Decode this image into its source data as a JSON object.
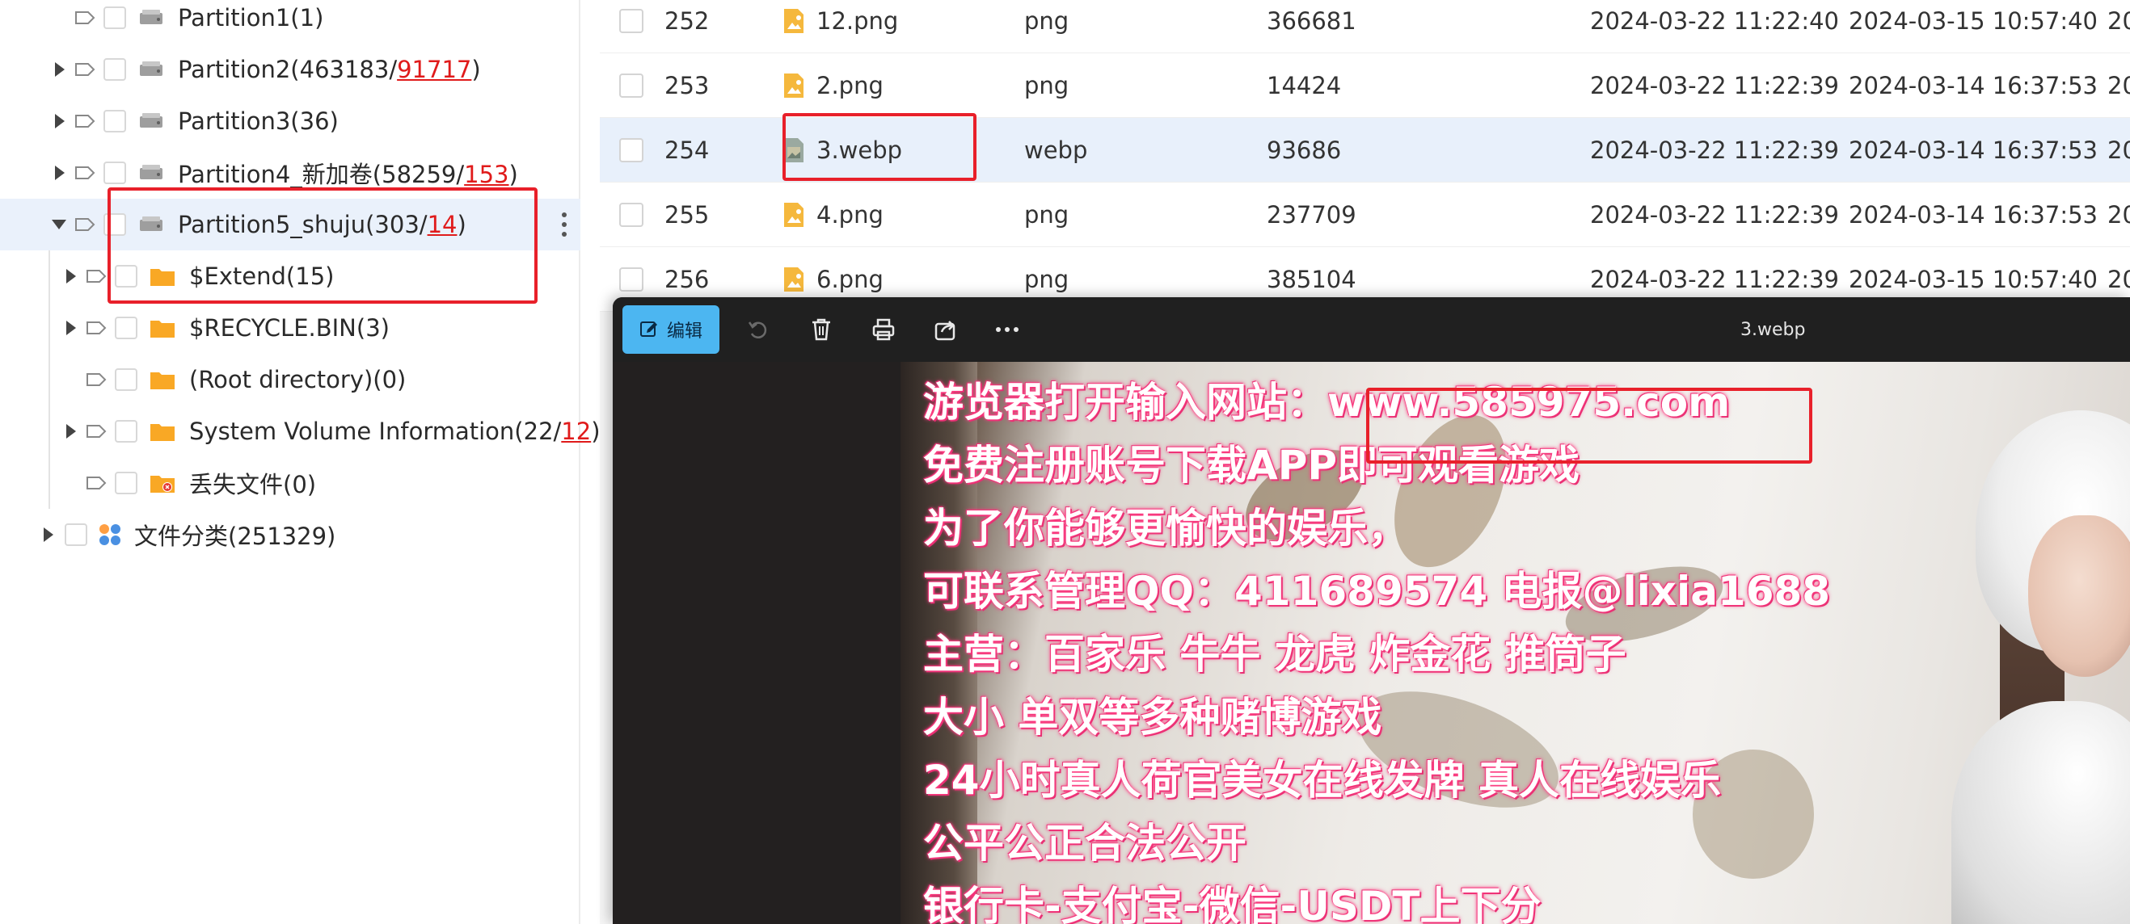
{
  "tree": {
    "items": [
      {
        "label": "Partition1(1)",
        "red": "",
        "tail": ""
      },
      {
        "label": "Partition2(463183/",
        "red": "91717",
        "tail": ")"
      },
      {
        "label": "Partition3(36)",
        "red": "",
        "tail": ""
      },
      {
        "label": "Partition4_新加卷(58259/",
        "red": "153",
        "tail": ")"
      },
      {
        "label": "Partition5_shuju(303/",
        "red": "14",
        "tail": ")"
      },
      {
        "label": "$Extend(15)",
        "red": "",
        "tail": ""
      },
      {
        "label": "$RECYCLE.BIN(3)",
        "red": "",
        "tail": ""
      },
      {
        "label": "(Root directory)(0)",
        "red": "",
        "tail": ""
      },
      {
        "label": "System Volume Information(22/",
        "red": "12",
        "tail": ")"
      },
      {
        "label": "丢失文件(0)",
        "red": "",
        "tail": ""
      },
      {
        "label": "文件分类(251329)",
        "red": "",
        "tail": ""
      }
    ]
  },
  "table": {
    "rows": [
      {
        "id": "252",
        "name": "12.png",
        "type": "png",
        "size": "366681",
        "modified": "2024-03-22 11:22:40",
        "created": "2024-03-15 10:57:40",
        "extra": "20"
      },
      {
        "id": "253",
        "name": "2.png",
        "type": "png",
        "size": "14424",
        "modified": "2024-03-22 11:22:39",
        "created": "2024-03-14 16:37:53",
        "extra": "20"
      },
      {
        "id": "254",
        "name": "3.webp",
        "type": "webp",
        "size": "93686",
        "modified": "2024-03-22 11:22:39",
        "created": "2024-03-14 16:37:53",
        "extra": "20"
      },
      {
        "id": "255",
        "name": "4.png",
        "type": "png",
        "size": "237709",
        "modified": "2024-03-22 11:22:39",
        "created": "2024-03-14 16:37:53",
        "extra": "20"
      },
      {
        "id": "256",
        "name": "6.png",
        "type": "png",
        "size": "385104",
        "modified": "2024-03-22 11:22:39",
        "created": "2024-03-15 10:57:40",
        "extra": "20"
      }
    ]
  },
  "viewer": {
    "edit_label": "编辑",
    "title": "3.webp",
    "toolbar_icons": [
      "edit-icon",
      "rotate-icon",
      "delete-icon",
      "print-icon",
      "share-icon",
      "more-icon"
    ]
  },
  "image_text": {
    "lines": [
      "游览器打开输入网站：www.585975.com",
      "免费注册账号下载APP即可观看游戏",
      "为了你能够更愉快的娱乐，",
      "可联系管理QQ：411689574 电报@lixia1688",
      "主营：百家乐 牛牛 龙虎 炸金花 推筒子",
      "大小 单双等多种赌博游戏",
      "24小时真人荷官美女在线发牌 真人在线娱乐",
      "公平公正合法公开",
      "银行卡-支付宝-微信-USDT上下分"
    ]
  },
  "colors": {
    "selected_row": "#e8f0fb",
    "highlight_red": "#e8202a",
    "edit_button": "#4cb6f1",
    "folder": "#f9a825"
  }
}
